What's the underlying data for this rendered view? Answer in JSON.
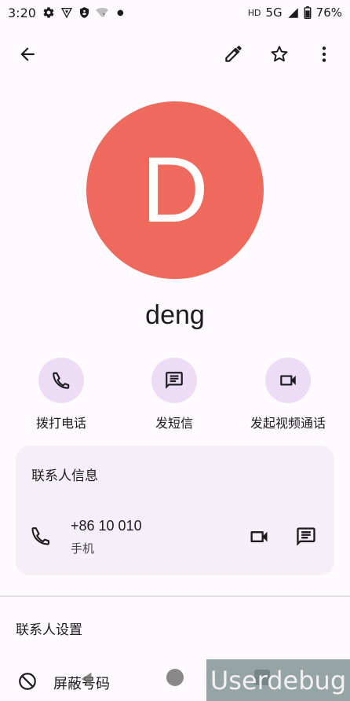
{
  "status_bar": {
    "time": "3:20",
    "network_label": "HD",
    "network_type": "5G",
    "battery": "76%",
    "icons": [
      "gear-icon",
      "vpn-icon",
      "shield-icon",
      "wifi-icon",
      "dot-icon",
      "signal-icon",
      "battery-icon"
    ]
  },
  "app_bar": {
    "icons": [
      "back-arrow-icon",
      "edit-pencil-icon",
      "star-icon",
      "more-vert-icon"
    ]
  },
  "contact": {
    "initial": "D",
    "name": "deng",
    "avatar_color": "#ee6a5d"
  },
  "actions": [
    {
      "label": "拨打电话",
      "icon": "phone-icon"
    },
    {
      "label": "发短信",
      "icon": "message-icon"
    },
    {
      "label": "发起视频通话",
      "icon": "videocam-icon"
    }
  ],
  "contact_info": {
    "title": "联系人信息",
    "phone_number": "+86 10 010",
    "phone_type": "手机"
  },
  "settings": {
    "title": "联系人设置",
    "block_label": "屏蔽号码"
  },
  "nav_bar": {
    "icons": [
      "nav-back-icon",
      "nav-home-icon",
      "nav-recents-icon"
    ]
  },
  "watermark": "Userdebug",
  "colors": {
    "background": "#fefafd",
    "action_circle": "#ecdcf5",
    "card_background": "#f5eff8",
    "avatar": "#ee6a5d"
  }
}
